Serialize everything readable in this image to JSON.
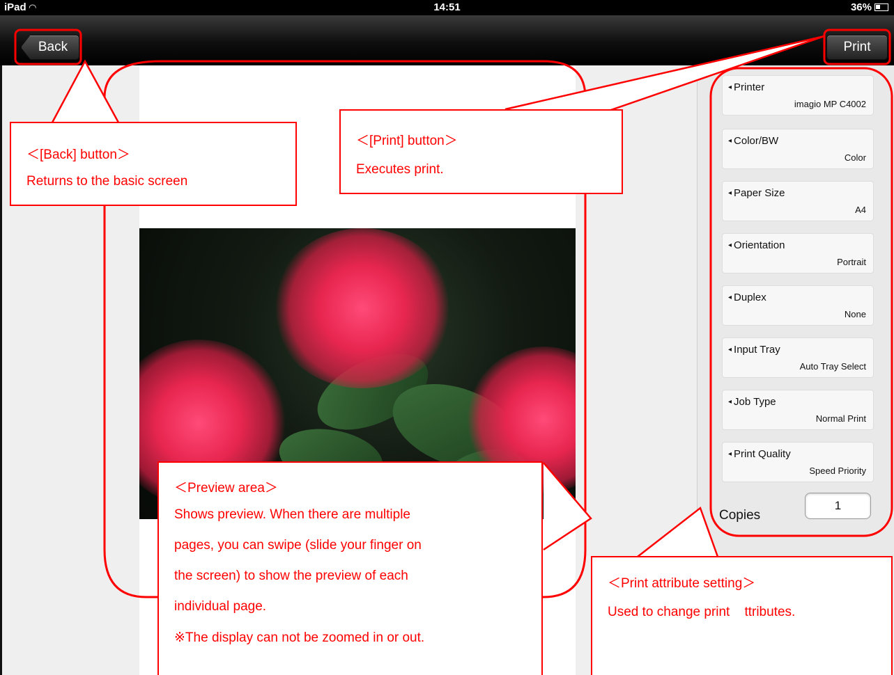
{
  "status_bar": {
    "device": "iPad",
    "time": "14:51",
    "battery": "36%"
  },
  "navbar": {
    "back_label": "Back",
    "print_label": "Print"
  },
  "settings": [
    {
      "label": "Printer",
      "value": "imagio MP C4002"
    },
    {
      "label": "Color/BW",
      "value": "Color"
    },
    {
      "label": "Paper Size",
      "value": "A4"
    },
    {
      "label": "Orientation",
      "value": "Portrait"
    },
    {
      "label": "Duplex",
      "value": "None"
    },
    {
      "label": "Input Tray",
      "value": "Auto Tray Select"
    },
    {
      "label": "Job Type",
      "value": "Normal Print"
    },
    {
      "label": "Print Quality",
      "value": "Speed Priority"
    }
  ],
  "copies": {
    "label": "Copies",
    "value": "1"
  },
  "annotations": {
    "back": {
      "title": "＜[Back] button＞",
      "desc": "Returns to the basic screen"
    },
    "print": {
      "title": "＜[Print] button＞",
      "desc": "Executes print."
    },
    "preview": {
      "title": "＜Preview area＞",
      "lines": [
        "Shows preview. When there are multiple",
        "pages, you can swipe (slide your finger on",
        "the screen) to show the preview of each",
        "individual page.",
        "※The display can not be zoomed in or out."
      ]
    },
    "attr": {
      "title": "＜Print attribute setting＞",
      "desc": "Used to change print    ttributes."
    }
  },
  "colors": {
    "annotation_red": "#ff0000",
    "navbar": "#111111",
    "page_bg": "#efeff0"
  }
}
